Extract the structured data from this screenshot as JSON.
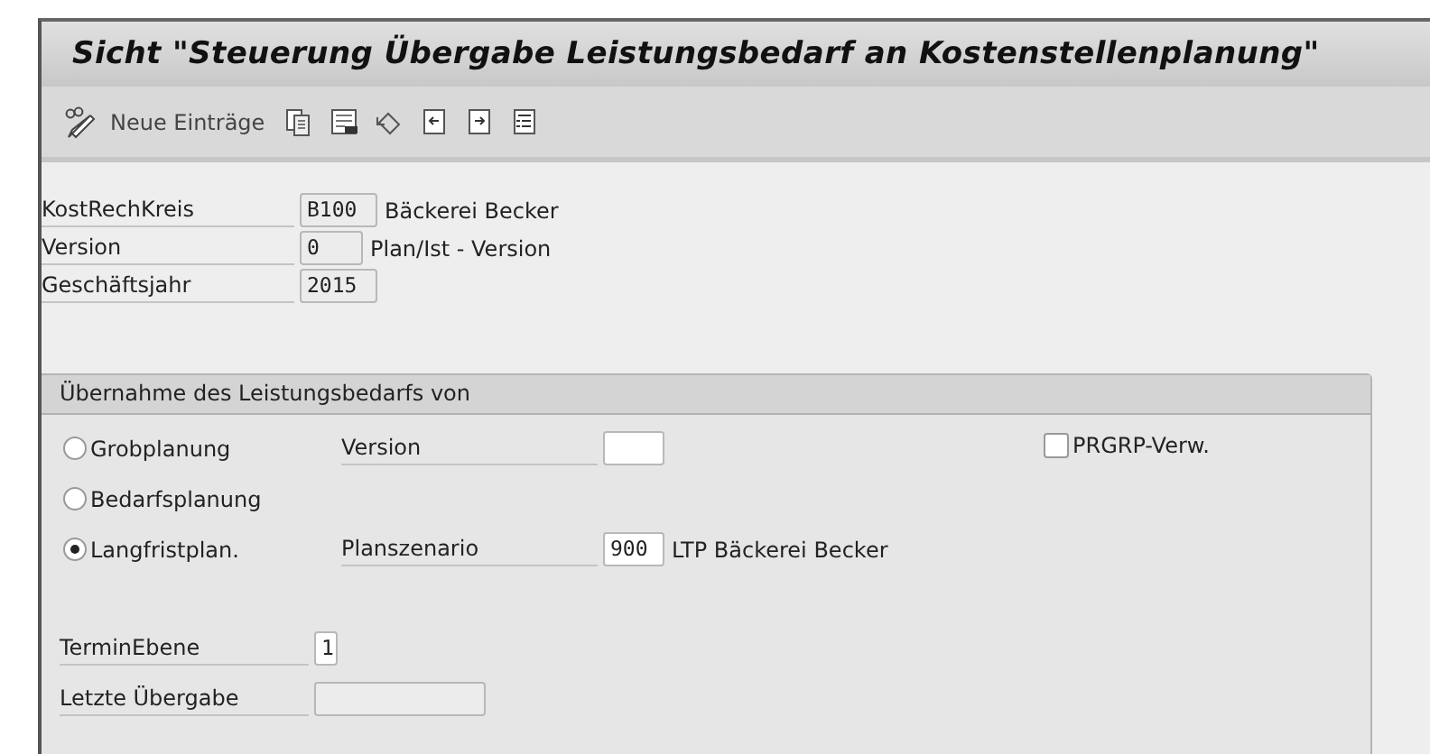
{
  "window": {
    "title": "Sicht \"Steuerung Übergabe Leistungsbedarf an Kostenstellenplanung\""
  },
  "toolbar": {
    "new_entries": "Neue Einträge"
  },
  "header_fields": [
    {
      "label": "KostRechKreis",
      "value": "B100",
      "description": "Bäckerei Becker",
      "disabled": true
    },
    {
      "label": "Version",
      "value": "0",
      "description": "Plan/Ist - Version",
      "disabled": true
    },
    {
      "label": "Geschäftsjahr",
      "value": "2015",
      "disabled": true
    }
  ],
  "group": {
    "title": "Übernahme des Leistungsbedarfs von",
    "options": [
      {
        "label": "Grobplanung",
        "selected": false,
        "field": {
          "label": "Version",
          "disabled": false
        }
      },
      {
        "label": "Bedarfsplanung",
        "selected": false
      },
      {
        "label": "Langfristplan.",
        "selected": true,
        "field": {
          "label": "Planszenario",
          "value": "900",
          "description": "LTP Bäckerei Becker",
          "disabled": false
        }
      }
    ],
    "checkbox": {
      "label": "PRGRP-Verw.",
      "checked": false
    },
    "fields": [
      {
        "label": "TerminEbene",
        "value": "1",
        "disabled": false
      },
      {
        "label": "Letzte Übergabe",
        "disabled": true
      }
    ]
  }
}
